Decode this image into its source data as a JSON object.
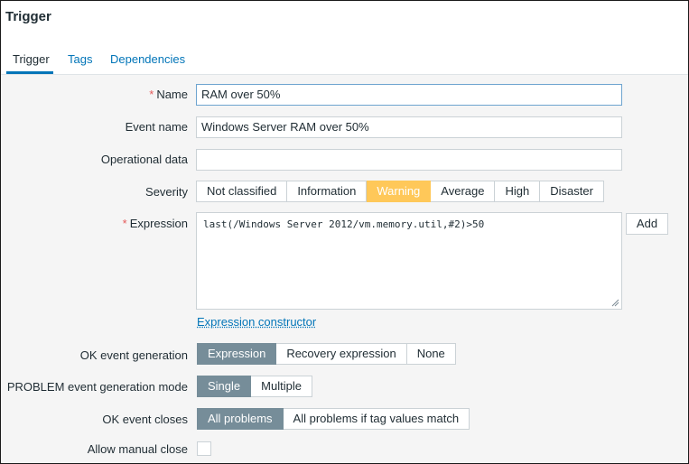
{
  "page": {
    "title": "Trigger"
  },
  "tabs": [
    {
      "label": "Trigger"
    },
    {
      "label": "Tags"
    },
    {
      "label": "Dependencies"
    }
  ],
  "form": {
    "name": {
      "label": "Name",
      "required_mark": "*",
      "value": "RAM over 50%"
    },
    "event_name": {
      "label": "Event name",
      "value": "Windows Server RAM over 50%"
    },
    "operational_data": {
      "label": "Operational data",
      "value": ""
    },
    "severity": {
      "label": "Severity",
      "options": [
        "Not classified",
        "Information",
        "Warning",
        "Average",
        "High",
        "Disaster"
      ],
      "selected": "Warning"
    },
    "expression": {
      "label": "Expression",
      "required_mark": "*",
      "value": "last(/Windows Server 2012/vm.memory.util,#2)>50",
      "add_label": "Add",
      "constructor_link": "Expression constructor"
    },
    "ok_event_generation": {
      "label": "OK event generation",
      "options": [
        "Expression",
        "Recovery expression",
        "None"
      ],
      "selected": "Expression"
    },
    "problem_event_generation_mode": {
      "label": "PROBLEM event generation mode",
      "options": [
        "Single",
        "Multiple"
      ],
      "selected": "Single"
    },
    "ok_event_closes": {
      "label": "OK event closes",
      "options": [
        "All problems",
        "All problems if tag values match"
      ],
      "selected": "All problems"
    },
    "allow_manual_close": {
      "label": "Allow manual close",
      "checked": false
    }
  },
  "colors": {
    "link": "#0275b8",
    "warning": "#ffc859",
    "selected": "#768d99",
    "required": "#e45959",
    "form_background": "#f5f5f5"
  }
}
